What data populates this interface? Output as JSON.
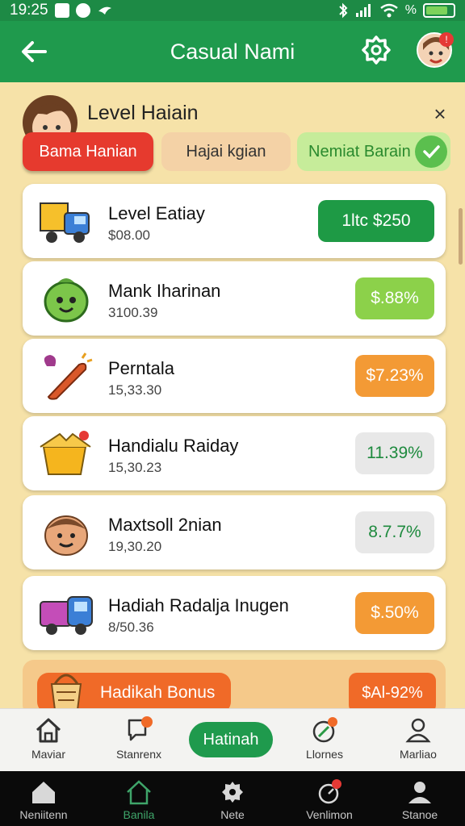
{
  "status": {
    "time": "19:25",
    "battery_label": "%"
  },
  "appbar": {
    "title": "Casual Nami"
  },
  "panel": {
    "level_title": "Level  Haiain",
    "close_label": "×",
    "chips": [
      "Bama Hanian",
      "Hajai kgian",
      "Nemiat Barain"
    ]
  },
  "items": [
    {
      "name": "Level Eatiay",
      "sub": "$08.00",
      "badge": "1ltc $250",
      "badge_bg": "#1e9a45",
      "badge_fg": "#ffffff"
    },
    {
      "name": "Mank Iharinan",
      "sub": "3100.39",
      "badge": "$.88%",
      "badge_bg": "#8cd14a",
      "badge_fg": "#ffffff"
    },
    {
      "name": "Perntala",
      "sub": "15,33.30",
      "badge": "$7.23%",
      "badge_bg": "#f39a35",
      "badge_fg": "#ffffff"
    },
    {
      "name": "Handialu Raiday",
      "sub": "15,30.23",
      "badge": "11.39%",
      "badge_bg": "#e8e8e8",
      "badge_fg": "#1e8a3e"
    },
    {
      "name": "Maxtsoll 2nian",
      "sub": "19,30.20",
      "badge": "8.7.7%",
      "badge_bg": "#e8e8e8",
      "badge_fg": "#1e8a3e"
    },
    {
      "name": "Hadiah Radalja Inugen",
      "sub": "8/50.36",
      "badge": "$.50%",
      "badge_bg": "#f39a35",
      "badge_fg": "#ffffff"
    }
  ],
  "bonus": {
    "label": "Hadikah Bonus",
    "badge": "$Al-92%"
  },
  "app_nav": {
    "items": [
      "Maviar",
      "Stanrenx",
      "Llornes",
      "Marliao"
    ],
    "center": "Hatinah"
  },
  "sys_nav": {
    "items": [
      "Neniitenn",
      "Banila",
      "Nete",
      "Venlimon",
      "Stanoe"
    ]
  }
}
